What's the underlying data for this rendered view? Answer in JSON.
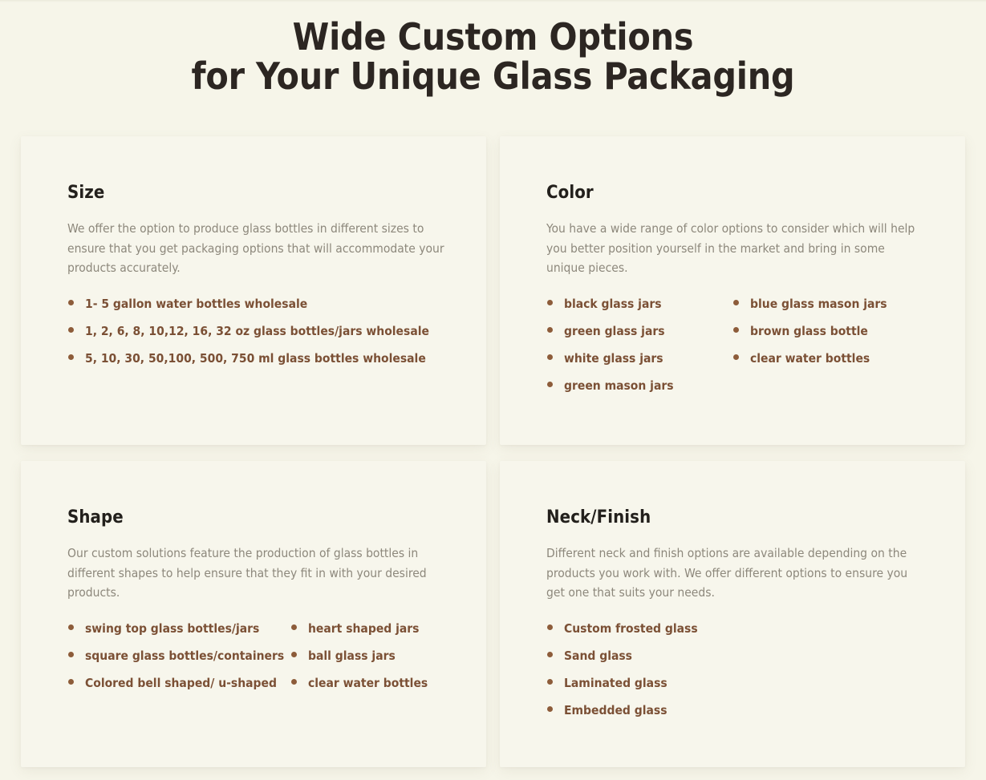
{
  "page": {
    "background_color": "#f6f5e9",
    "card_background_color": "#f7f6ec",
    "heading_color": "#2c2622",
    "body_text_color": "#8d887c",
    "bullet_text_color": "#7b5035",
    "bullet_dot_color": "#8d5c3a",
    "title_line_1": "Wide Custom Options",
    "title_line_2": "for Your Unique Glass Packaging"
  },
  "cards": [
    {
      "id": "size",
      "title": "Size",
      "description": "We offer the option to produce glass bottles in different sizes to ensure that you get packaging options that will accommodate your products accurately.",
      "layout": "single-column",
      "items": [
        "1- 5 gallon water bottles wholesale",
        "1, 2, 6, 8, 10,12, 16, 32 oz glass bottles/jars wholesale",
        "5, 10, 30, 50,100, 500, 750 ml glass bottles wholesale"
      ]
    },
    {
      "id": "color",
      "title": "Color",
      "description": "You have a wide range of color options to consider which will help you better position yourself in the market and bring in some unique pieces.",
      "layout": "two-column",
      "items_col1": [
        "black glass jars",
        "green glass jars",
        "white glass jars",
        "green mason jars"
      ],
      "items_col2": [
        "blue glass mason jars",
        "brown glass bottle",
        "clear water bottles"
      ]
    },
    {
      "id": "shape",
      "title": "Shape",
      "description": "Our custom solutions feature the production of glass bottles in different shapes to help ensure that they fit in with your desired products.",
      "layout": "two-column",
      "items_col1": [
        "swing top glass bottles/jars",
        "square glass bottles/containers",
        "Colored bell shaped/ u-shaped"
      ],
      "items_col2": [
        "heart shaped jars",
        "ball glass jars",
        "clear water bottles"
      ]
    },
    {
      "id": "neck_finish",
      "title": "Neck/Finish",
      "description": "Different neck and finish options are available depending on the products you work with. We offer different options to ensure you get one that suits your needs.",
      "layout": "single-column",
      "items": [
        "Custom frosted glass",
        "Sand glass",
        "Laminated glass",
        "Embedded glass"
      ]
    }
  ]
}
